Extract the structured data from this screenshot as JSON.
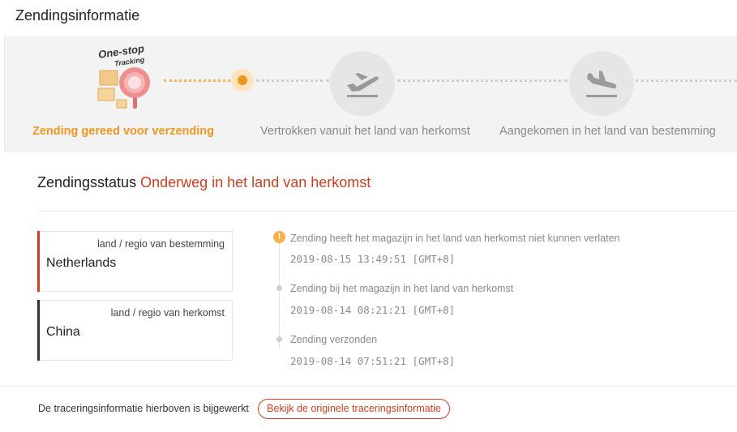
{
  "header": {
    "title": "Zendingsinformatie"
  },
  "logo": {
    "line1": "One-stop",
    "line2": "Tracking"
  },
  "steps": [
    {
      "label": "Zending gereed voor verzending",
      "state": "done"
    },
    {
      "label": "Vertrokken vanuit het land van herkomst",
      "state": "pending",
      "icon": "plane-takeoff-icon"
    },
    {
      "label": "Aangekomen in het land van bestemming",
      "state": "pending",
      "icon": "plane-landing-icon"
    }
  ],
  "status": {
    "label": "Zendingsstatus",
    "value": "Onderweg in het land van herkomst"
  },
  "locations": [
    {
      "title": "land / regio van bestemming",
      "country": "Netherlands",
      "accent": "#d23c1e"
    },
    {
      "title": "land / regio van herkomst",
      "country": "China",
      "accent": "#333333"
    }
  ],
  "events": [
    {
      "text": "Zending heeft het magazijn in het land van herkomst niet kunnen verlaten",
      "time": "2019-08-15 13:49:51 [GMT+8]",
      "alert": true
    },
    {
      "text": "Zending bij het magazijn in het land van herkomst",
      "time": "2019-08-14 08:21:21 [GMT+8]",
      "alert": false
    },
    {
      "text": "Zending verzonden",
      "time": "2019-08-14 07:51:21 [GMT+8]",
      "alert": false
    }
  ],
  "alert_icon_glyph": "!",
  "footer": {
    "note": "De traceringsinformatie hierboven is bijgewerkt",
    "button_label": "Bekijk de originele traceringsinformatie"
  },
  "colors": {
    "accent_orange": "#f0961e",
    "status_red": "#d23c1e"
  }
}
